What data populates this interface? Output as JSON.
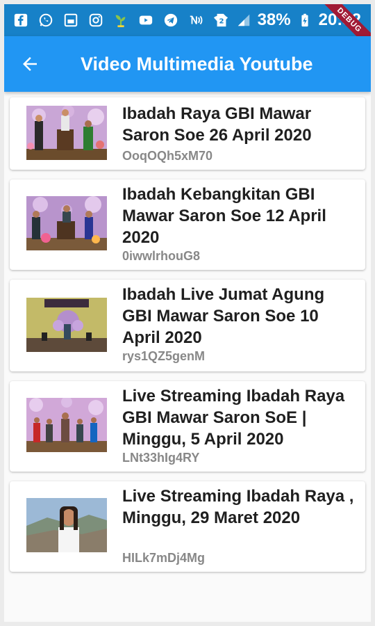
{
  "status_bar": {
    "battery": "38%",
    "time": "20:32",
    "debug": "DEBUG"
  },
  "app_bar": {
    "title": "Video Multimedia Youtube",
    "back_icon": "arrow-left-icon"
  },
  "videos": [
    {
      "title": "Ibadah Raya GBI Mawar Saron Soe 26 April 2020",
      "id": "OoqOQh5xM70"
    },
    {
      "title": "Ibadah Kebangkitan GBI Mawar Saron Soe 12 April 2020",
      "id": "0iwwlrhouG8"
    },
    {
      "title": "Ibadah Live Jumat Agung GBI Mawar Saron Soe 10 April 2020",
      "id": "rys1QZ5genM"
    },
    {
      "title": "Live Streaming Ibadah Raya GBI Mawar Saron SoE | Minggu, 5 April 2020",
      "id": "LNt33hIg4RY"
    },
    {
      "title": "Live Streaming Ibadah Raya , Minggu, 29 Maret 2020",
      "id": "HILk7mDj4Mg"
    }
  ],
  "colors": {
    "status_bar": "#1781c8",
    "app_bar": "#2196f3",
    "debug_ribbon": "#a01a35"
  }
}
